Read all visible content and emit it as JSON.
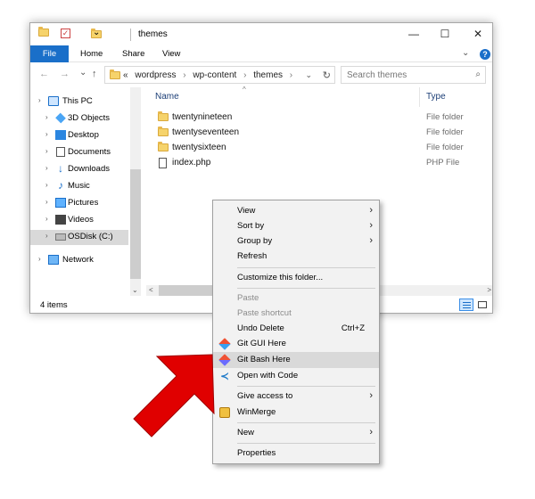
{
  "window": {
    "title": "themes",
    "controls": {
      "minimize": "—",
      "maximize": "☐",
      "close": "✕"
    }
  },
  "ribbon": {
    "tabs": [
      {
        "label": "File"
      },
      {
        "label": "Home"
      },
      {
        "label": "Share"
      },
      {
        "label": "View"
      }
    ],
    "expand": "⌄",
    "help": "?"
  },
  "nav": {
    "back": "←",
    "forward": "→",
    "recent": "⌄",
    "up": "↑"
  },
  "address": {
    "overflow": "«",
    "path": [
      "wordpress",
      "wp-content",
      "themes"
    ],
    "separator": "›",
    "dropdown": "⌄",
    "refresh": "↻"
  },
  "search": {
    "placeholder": "Search themes",
    "icon": "⌕"
  },
  "navpane": {
    "items": [
      {
        "label": "This PC",
        "icon": "pc-icon"
      },
      {
        "label": "3D Objects",
        "icon": "cube-icon"
      },
      {
        "label": "Desktop",
        "icon": "desktop-icon"
      },
      {
        "label": "Documents",
        "icon": "documents-icon"
      },
      {
        "label": "Downloads",
        "icon": "download-icon"
      },
      {
        "label": "Music",
        "icon": "music-icon"
      },
      {
        "label": "Pictures",
        "icon": "pictures-icon"
      },
      {
        "label": "Videos",
        "icon": "videos-icon"
      },
      {
        "label": "OSDisk (C:)",
        "icon": "disk-icon",
        "selected": true
      },
      {
        "label": "Network",
        "icon": "network-icon"
      }
    ],
    "expander": "›"
  },
  "columns": {
    "name": "Name",
    "type": "Type",
    "sort_indicator": "^"
  },
  "files": [
    {
      "name": "twentynineteen",
      "type": "File folder",
      "kind": "folder"
    },
    {
      "name": "twentyseventeen",
      "type": "File folder",
      "kind": "folder"
    },
    {
      "name": "twentysixteen",
      "type": "File folder",
      "kind": "folder"
    },
    {
      "name": "index.php",
      "type": "PHP File",
      "kind": "file"
    }
  ],
  "scroll": {
    "down": "⌄",
    "left": "<",
    "right": ">"
  },
  "status": {
    "count": "4 items"
  },
  "context_menu": {
    "items": [
      {
        "label": "View",
        "submenu": true
      },
      {
        "label": "Sort by",
        "submenu": true
      },
      {
        "label": "Group by",
        "submenu": true
      },
      {
        "label": "Refresh"
      },
      {
        "separator": true
      },
      {
        "label": "Customize this folder..."
      },
      {
        "separator": true
      },
      {
        "label": "Paste",
        "disabled": true
      },
      {
        "label": "Paste shortcut",
        "disabled": true
      },
      {
        "label": "Undo Delete",
        "shortcut": "Ctrl+Z"
      },
      {
        "label": "Git GUI Here",
        "icon": "git-gui-icon"
      },
      {
        "label": "Git Bash Here",
        "icon": "git-bash-icon",
        "highlighted": true
      },
      {
        "label": "Open with Code",
        "icon": "vscode-icon"
      },
      {
        "separator": true
      },
      {
        "label": "Give access to",
        "submenu": true
      },
      {
        "label": "WinMerge",
        "icon": "winmerge-icon"
      },
      {
        "separator": true
      },
      {
        "label": "New",
        "submenu": true
      },
      {
        "separator": true
      },
      {
        "label": "Properties"
      }
    ],
    "submenu_arrow": "›",
    "vscode_glyph": "≺"
  },
  "colors": {
    "accent": "#1a6fc9",
    "arrow": "#e00000",
    "highlight": "#d9d9d9"
  }
}
